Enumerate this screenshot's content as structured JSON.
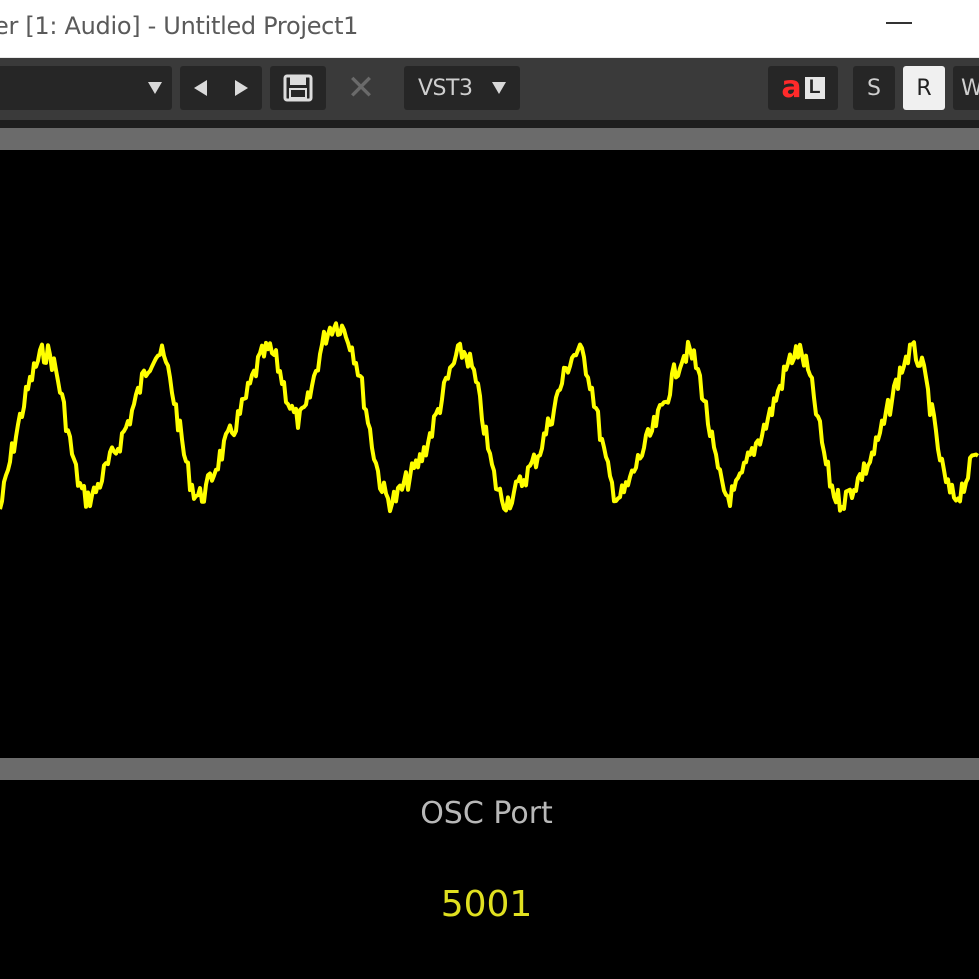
{
  "window": {
    "title": "er [1: Audio] - Untitled Project1"
  },
  "toolbar": {
    "preset_value": "",
    "plugin_format": "VST3",
    "close_label": "✕",
    "al_a": "a",
    "al_l": "L",
    "s_label": "S",
    "r_label": "R",
    "w_label": "W"
  },
  "scope": {
    "trace_color": "#ffff00",
    "background": "#000000"
  },
  "osc": {
    "label": "OSC Port",
    "value": "5001"
  }
}
